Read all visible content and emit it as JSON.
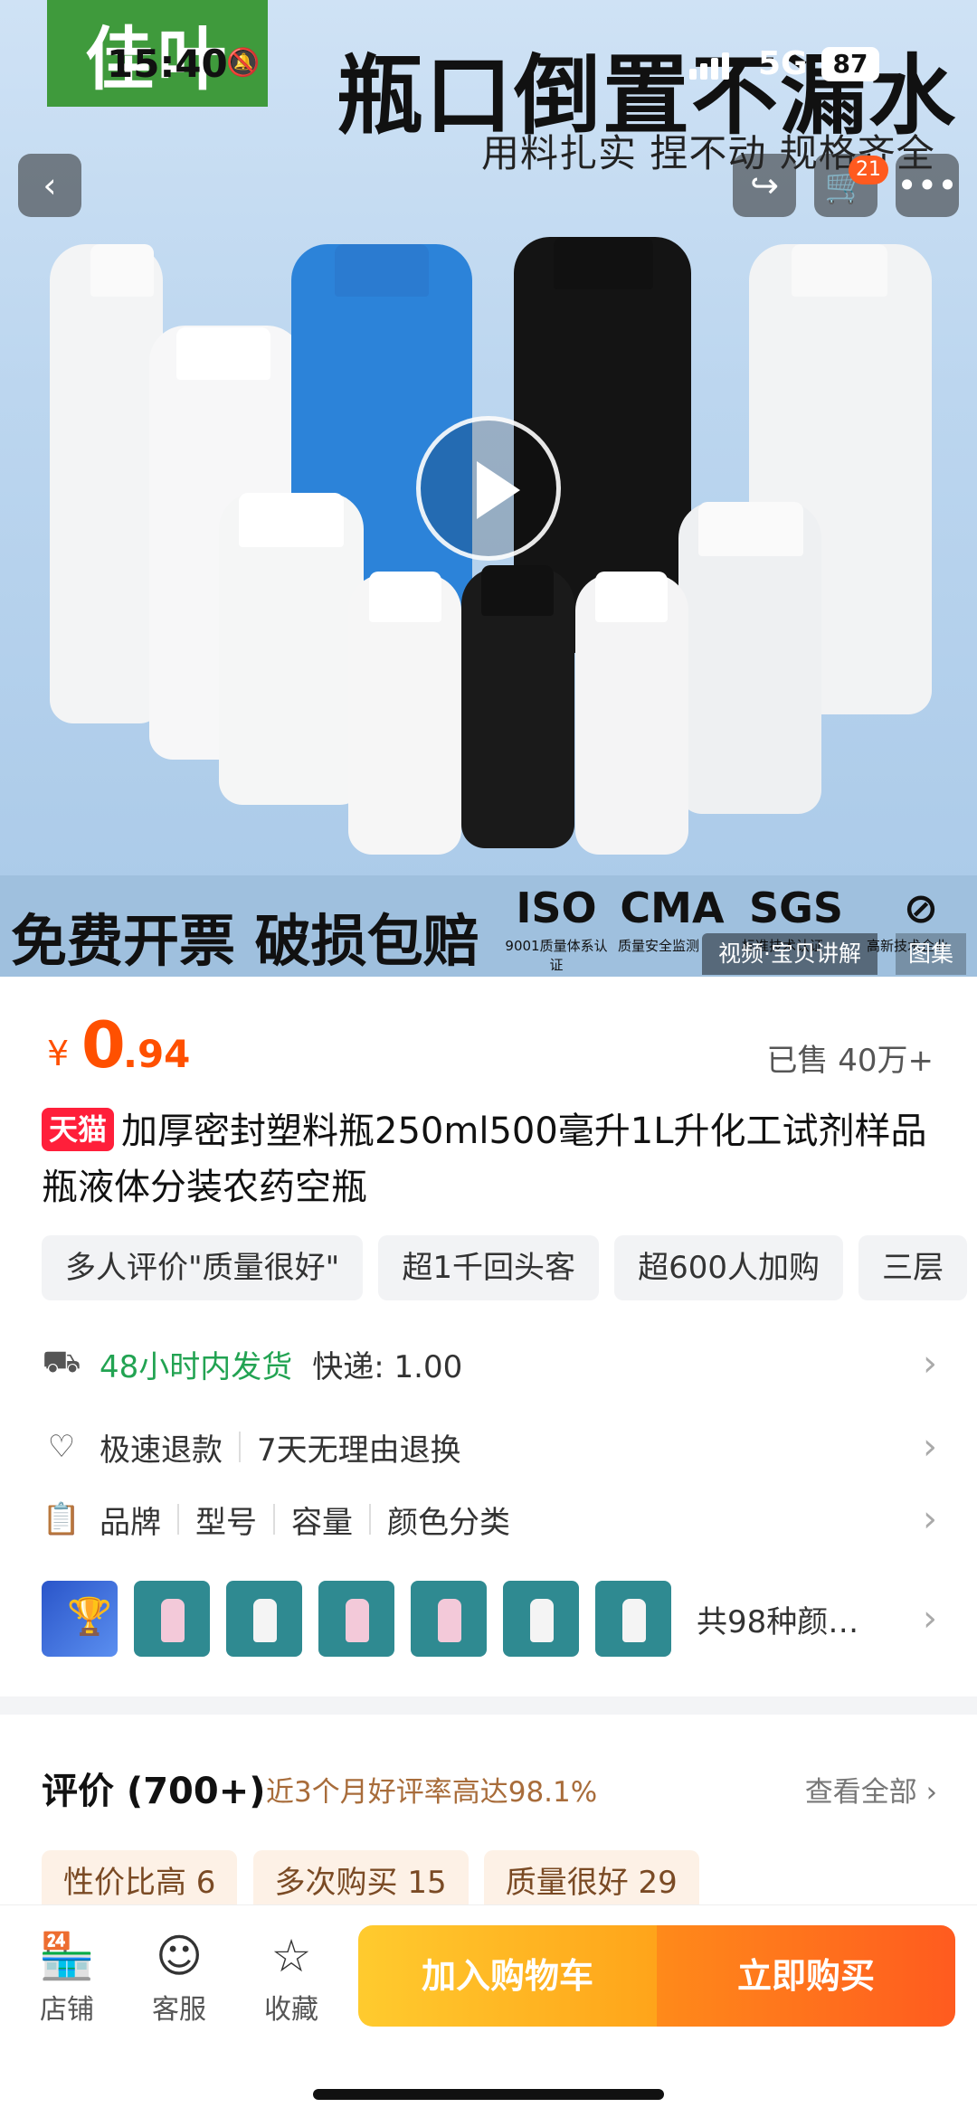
{
  "status_bar": {
    "time": "15:40",
    "network": "5G",
    "battery": "87"
  },
  "hero": {
    "brand_logo": "佳叶",
    "headline": "瓶口倒置不漏水",
    "subline": "用料扎实 捏不动 规格齐全",
    "bottom_text": "免费开票 破损包赔",
    "certs": [
      {
        "mark": "ISO",
        "caption": "9001质量体系认证"
      },
      {
        "mark": "CMA",
        "caption": "质量安全监测"
      },
      {
        "mark": "SGS",
        "caption": "标准技术认证"
      },
      {
        "mark": "",
        "caption": "高新技术企业"
      }
    ],
    "video_badge": "视频·宝贝讲解",
    "gallery_badge": "图集",
    "cart_count": "21"
  },
  "product": {
    "price_currency": "¥",
    "price_int": "0",
    "price_dec": ".94",
    "sold": "已售 40万+",
    "badge": "天猫",
    "title": "加厚密封塑料瓶250ml500毫升1L升化工试剂样品瓶液体分装农药空瓶",
    "tags": [
      "多人评价\"质量很好\"",
      "超1千回头客",
      "超600人加购",
      "三层"
    ]
  },
  "shipping": {
    "label": "48小时内发货",
    "fee": "快递: 1.00"
  },
  "service": {
    "label1": "极速退款",
    "label2": "7天无理由退换"
  },
  "params": [
    "品牌",
    "型号",
    "容量",
    "颜色分类"
  ],
  "variants": {
    "text": "共98种颜…"
  },
  "reviews": {
    "title": "评价 (700+)",
    "rate": "近3个月好评率高达98.1%",
    "view_all": "查看全部",
    "tags": [
      "性价比高 6",
      "多次购买 15",
      "质量很好 29"
    ]
  },
  "bottom_bar": {
    "shop": "店铺",
    "service": "客服",
    "favorite": "收藏",
    "add_cart": "加入购物车",
    "buy_now": "立即购买"
  }
}
